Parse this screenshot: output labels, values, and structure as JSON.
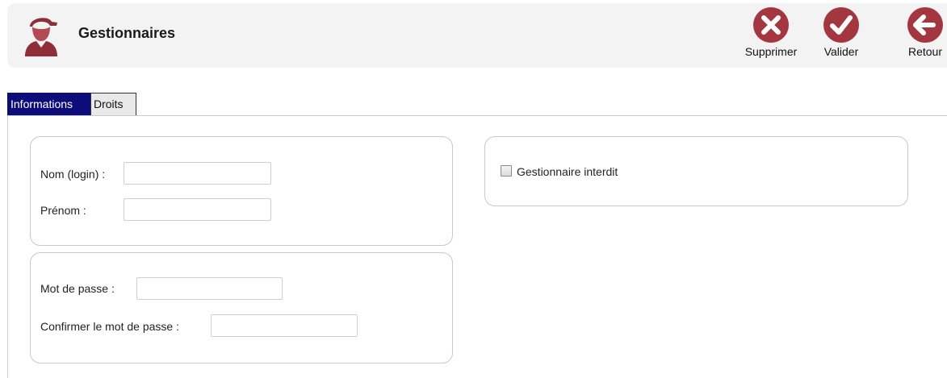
{
  "header": {
    "title": "Gestionnaires",
    "icon": "user-icon",
    "actions": [
      {
        "label": "Supprimer",
        "icon": "delete-icon",
        "color": "#a4363f"
      },
      {
        "label": "Valider",
        "icon": "check-icon",
        "color": "#a4363f"
      },
      {
        "label": "Retour",
        "icon": "back-arrow-icon",
        "color": "#a4363f"
      }
    ]
  },
  "tabs": [
    {
      "label": "Informations",
      "active": true
    },
    {
      "label": "Droits",
      "active": false
    }
  ],
  "identity": {
    "login_label": "Nom (login) :",
    "login_value": "",
    "firstname_label": "Prénom :",
    "firstname_value": ""
  },
  "password": {
    "password_label": "Mot de passe :",
    "password_value": "",
    "confirm_label": "Confirmer le mot de passe :",
    "confirm_value": ""
  },
  "flags": {
    "forbidden_label": "Gestionnaire interdit",
    "forbidden_checked": false
  },
  "colors": {
    "accent": "#a4363f",
    "active_tab": "#0c0c7a"
  }
}
